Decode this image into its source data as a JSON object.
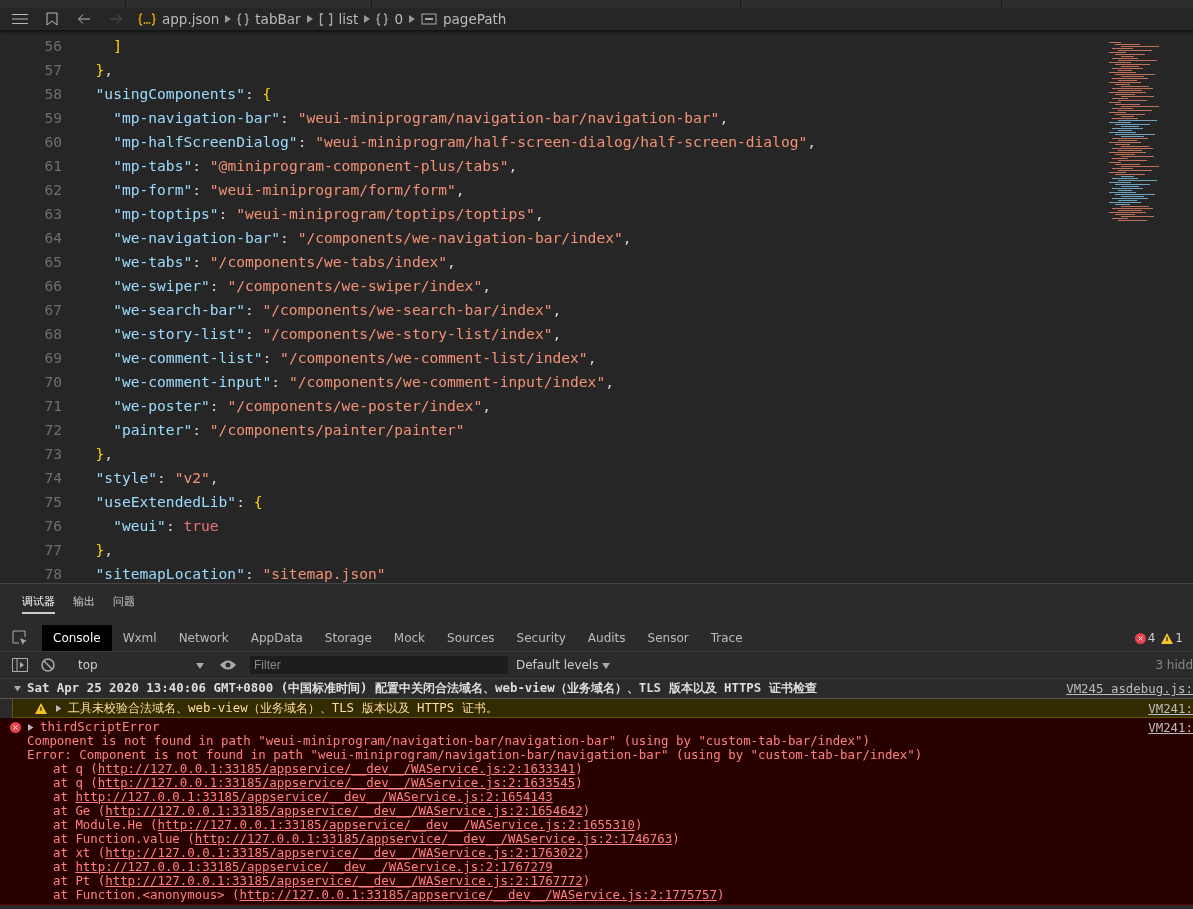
{
  "breadcrumb": [
    {
      "kind": "object-file",
      "label": "app.json"
    },
    {
      "kind": "object",
      "label": "tabBar"
    },
    {
      "kind": "array",
      "label": "list"
    },
    {
      "kind": "object",
      "label": "0"
    },
    {
      "kind": "text",
      "label": "pagePath"
    }
  ],
  "code_lines": [
    {
      "number": "56",
      "tokens": [
        {
          "kind": "bracket",
          "text": "    ]"
        }
      ]
    },
    {
      "number": "57",
      "tokens": [
        {
          "kind": "bracket",
          "text": "  }"
        },
        {
          "kind": "punct",
          "text": ","
        }
      ]
    },
    {
      "number": "58",
      "tokens": [
        {
          "kind": "key",
          "text": "  \"usingComponents\""
        },
        {
          "kind": "punct",
          "text": ": "
        },
        {
          "kind": "bracket",
          "text": "{"
        }
      ]
    },
    {
      "number": "59",
      "tokens": [
        {
          "kind": "key",
          "text": "    \"mp-navigation-bar\""
        },
        {
          "kind": "punct",
          "text": ": "
        },
        {
          "kind": "string",
          "text": "\"weui-miniprogram/navigation-bar/navigation-bar\""
        },
        {
          "kind": "punct",
          "text": ","
        }
      ]
    },
    {
      "number": "60",
      "tokens": [
        {
          "kind": "key",
          "text": "    \"mp-halfScreenDialog\""
        },
        {
          "kind": "punct",
          "text": ": "
        },
        {
          "kind": "string",
          "text": "\"weui-miniprogram/half-screen-dialog/half-screen-dialog\""
        },
        {
          "kind": "punct",
          "text": ","
        }
      ]
    },
    {
      "number": "61",
      "tokens": [
        {
          "kind": "key",
          "text": "    \"mp-tabs\""
        },
        {
          "kind": "punct",
          "text": ": "
        },
        {
          "kind": "string",
          "text": "\"@miniprogram-component-plus/tabs\""
        },
        {
          "kind": "punct",
          "text": ","
        }
      ]
    },
    {
      "number": "62",
      "tokens": [
        {
          "kind": "key",
          "text": "    \"mp-form\""
        },
        {
          "kind": "punct",
          "text": ": "
        },
        {
          "kind": "string",
          "text": "\"weui-miniprogram/form/form\""
        },
        {
          "kind": "punct",
          "text": ","
        }
      ]
    },
    {
      "number": "63",
      "tokens": [
        {
          "kind": "key",
          "text": "    \"mp-toptips\""
        },
        {
          "kind": "punct",
          "text": ": "
        },
        {
          "kind": "string",
          "text": "\"weui-miniprogram/toptips/toptips\""
        },
        {
          "kind": "punct",
          "text": ","
        }
      ]
    },
    {
      "number": "64",
      "tokens": [
        {
          "kind": "key",
          "text": "    \"we-navigation-bar\""
        },
        {
          "kind": "punct",
          "text": ": "
        },
        {
          "kind": "string",
          "text": "\"/components/we-navigation-bar/index\""
        },
        {
          "kind": "punct",
          "text": ","
        }
      ]
    },
    {
      "number": "65",
      "tokens": [
        {
          "kind": "key",
          "text": "    \"we-tabs\""
        },
        {
          "kind": "punct",
          "text": ": "
        },
        {
          "kind": "string",
          "text": "\"/components/we-tabs/index\""
        },
        {
          "kind": "punct",
          "text": ","
        }
      ]
    },
    {
      "number": "66",
      "tokens": [
        {
          "kind": "key",
          "text": "    \"we-swiper\""
        },
        {
          "kind": "punct",
          "text": ": "
        },
        {
          "kind": "string",
          "text": "\"/components/we-swiper/index\""
        },
        {
          "kind": "punct",
          "text": ","
        }
      ]
    },
    {
      "number": "67",
      "tokens": [
        {
          "kind": "key",
          "text": "    \"we-search-bar\""
        },
        {
          "kind": "punct",
          "text": ": "
        },
        {
          "kind": "string",
          "text": "\"/components/we-search-bar/index\""
        },
        {
          "kind": "punct",
          "text": ","
        }
      ]
    },
    {
      "number": "68",
      "tokens": [
        {
          "kind": "key",
          "text": "    \"we-story-list\""
        },
        {
          "kind": "punct",
          "text": ": "
        },
        {
          "kind": "string",
          "text": "\"/components/we-story-list/index\""
        },
        {
          "kind": "punct",
          "text": ","
        }
      ]
    },
    {
      "number": "69",
      "tokens": [
        {
          "kind": "key",
          "text": "    \"we-comment-list\""
        },
        {
          "kind": "punct",
          "text": ": "
        },
        {
          "kind": "string",
          "text": "\"/components/we-comment-list/index\""
        },
        {
          "kind": "punct",
          "text": ","
        }
      ]
    },
    {
      "number": "70",
      "tokens": [
        {
          "kind": "key",
          "text": "    \"we-comment-input\""
        },
        {
          "kind": "punct",
          "text": ": "
        },
        {
          "kind": "string",
          "text": "\"/components/we-comment-input/index\""
        },
        {
          "kind": "punct",
          "text": ","
        }
      ]
    },
    {
      "number": "71",
      "tokens": [
        {
          "kind": "key",
          "text": "    \"we-poster\""
        },
        {
          "kind": "punct",
          "text": ": "
        },
        {
          "kind": "string",
          "text": "\"/components/we-poster/index\""
        },
        {
          "kind": "punct",
          "text": ","
        }
      ]
    },
    {
      "number": "72",
      "tokens": [
        {
          "kind": "key",
          "text": "    \"painter\""
        },
        {
          "kind": "punct",
          "text": ": "
        },
        {
          "kind": "string",
          "text": "\"/components/painter/painter\""
        }
      ]
    },
    {
      "number": "73",
      "tokens": [
        {
          "kind": "bracket",
          "text": "  }"
        },
        {
          "kind": "punct",
          "text": ","
        }
      ]
    },
    {
      "number": "74",
      "tokens": [
        {
          "kind": "key",
          "text": "  \"style\""
        },
        {
          "kind": "punct",
          "text": ": "
        },
        {
          "kind": "string",
          "text": "\"v2\""
        },
        {
          "kind": "punct",
          "text": ","
        }
      ]
    },
    {
      "number": "75",
      "tokens": [
        {
          "kind": "key",
          "text": "  \"useExtendedLib\""
        },
        {
          "kind": "punct",
          "text": ": "
        },
        {
          "kind": "bracket",
          "text": "{"
        }
      ]
    },
    {
      "number": "76",
      "tokens": [
        {
          "kind": "key",
          "text": "    \"weui\""
        },
        {
          "kind": "punct",
          "text": ": "
        },
        {
          "kind": "bool",
          "text": "true"
        }
      ]
    },
    {
      "number": "77",
      "tokens": [
        {
          "kind": "bracket",
          "text": "  }"
        },
        {
          "kind": "punct",
          "text": ","
        }
      ]
    },
    {
      "number": "78",
      "tokens": [
        {
          "kind": "key",
          "text": "  \"sitemapLocation\""
        },
        {
          "kind": "punct",
          "text": ": "
        },
        {
          "kind": "string",
          "text": "\"sitemap.json\""
        }
      ]
    }
  ],
  "panel_tabs": [
    {
      "label": "调试器",
      "selected": true
    },
    {
      "label": "输出",
      "selected": false
    },
    {
      "label": "问题",
      "selected": false
    }
  ],
  "devtools_tabs": [
    {
      "label": "Console",
      "selected": true
    },
    {
      "label": "Wxml",
      "selected": false
    },
    {
      "label": "Network",
      "selected": false
    },
    {
      "label": "AppData",
      "selected": false
    },
    {
      "label": "Storage",
      "selected": false
    },
    {
      "label": "Mock",
      "selected": false
    },
    {
      "label": "Sources",
      "selected": false
    },
    {
      "label": "Security",
      "selected": false
    },
    {
      "label": "Audits",
      "selected": false
    },
    {
      "label": "Sensor",
      "selected": false
    },
    {
      "label": "Trace",
      "selected": false
    }
  ],
  "error_count": "4",
  "warning_count": "1",
  "context": "top",
  "filter": {
    "placeholder": "Filter"
  },
  "levels": "Default levels",
  "hidden": "3 hidd",
  "messages": [
    {
      "kind": "group",
      "text": "Sat Apr 25 2020 13:40:06 GMT+0800 (中国标准时间) 配置中关闭合法域名、web-view（业务域名）、TLS 版本以及 HTTPS 证书检查",
      "source": "VM245 asdebug.js:"
    },
    {
      "kind": "warning",
      "text": "工具未校验合法域名、web-view（业务域名）、TLS 版本以及 HTTPS 证书。",
      "source": "VM241:"
    },
    {
      "kind": "error",
      "text": "thirdScriptError",
      "source": "VM241:",
      "details": [
        "Component is not found in path \"weui-miniprogram/navigation-bar/navigation-bar\" (using by \"custom-tab-bar/index\")",
        "Error: Component is not found in path \"weui-miniprogram/navigation-bar/navigation-bar\" (using by \"custom-tab-bar/index\")"
      ],
      "stack": [
        {
          "prefix": "at q (",
          "url": "http://127.0.0.1:33185/appservice/__dev__/WAService.js:2:1633341",
          "suffix": ")"
        },
        {
          "prefix": "at q (",
          "url": "http://127.0.0.1:33185/appservice/__dev__/WAService.js:2:1633545",
          "suffix": ")"
        },
        {
          "prefix": "at ",
          "url": "http://127.0.0.1:33185/appservice/__dev__/WAService.js:2:1654143"
        },
        {
          "prefix": "at Ge (",
          "url": "http://127.0.0.1:33185/appservice/__dev__/WAService.js:2:1654642",
          "suffix": ")"
        },
        {
          "prefix": "at Module.He (",
          "url": "http://127.0.0.1:33185/appservice/__dev__/WAService.js:2:1655310",
          "suffix": ")"
        },
        {
          "prefix": "at Function.value (",
          "url": "http://127.0.0.1:33185/appservice/__dev__/WAService.js:2:1746763",
          "suffix": ")"
        },
        {
          "prefix": "at xt (",
          "url": "http://127.0.0.1:33185/appservice/__dev__/WAService.js:2:1763022",
          "suffix": ")"
        },
        {
          "prefix": "at ",
          "url": "http://127.0.0.1:33185/appservice/__dev__/WAService.js:2:1767279"
        },
        {
          "prefix": "at Pt (",
          "url": "http://127.0.0.1:33185/appservice/__dev__/WAService.js:2:1767772",
          "suffix": ")"
        },
        {
          "prefix": "at Function.<anonymous> (",
          "url": "http://127.0.0.1:33185/appservice/__dev__/WAService.js:2:1775757",
          "suffix": ")"
        }
      ]
    }
  ]
}
